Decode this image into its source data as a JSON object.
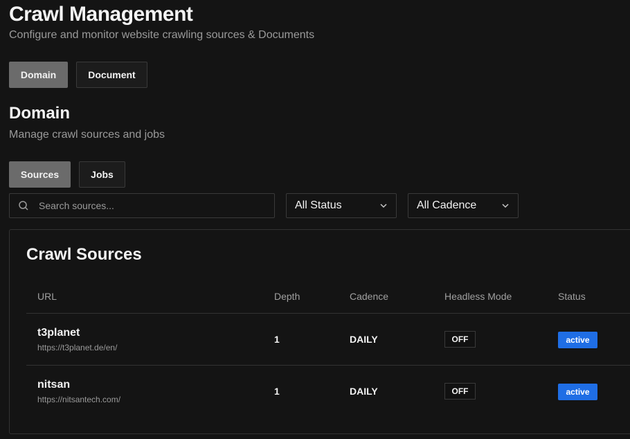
{
  "header": {
    "title": "Crawl Management",
    "subtitle": "Configure and monitor website crawling sources & Documents"
  },
  "top_tabs": [
    {
      "label": "Domain",
      "active": true
    },
    {
      "label": "Document",
      "active": false
    }
  ],
  "section": {
    "title": "Domain",
    "subtitle": "Manage crawl sources and jobs"
  },
  "sub_tabs": [
    {
      "label": "Sources",
      "active": true
    },
    {
      "label": "Jobs",
      "active": false
    }
  ],
  "filters": {
    "search_placeholder": "Search sources...",
    "status_value": "All Status",
    "cadence_value": "All Cadence"
  },
  "table": {
    "title": "Crawl Sources",
    "columns": [
      "URL",
      "Depth",
      "Cadence",
      "Headless Mode",
      "Status"
    ],
    "rows": [
      {
        "name": "t3planet",
        "url": "https://t3planet.de/en/",
        "depth": "1",
        "cadence": "DAILY",
        "headless": "OFF",
        "status": "active"
      },
      {
        "name": "nitsan",
        "url": "https://nitsantech.com/",
        "depth": "1",
        "cadence": "DAILY",
        "headless": "OFF",
        "status": "active"
      }
    ]
  },
  "colors": {
    "background": "#141414",
    "active_tab": "#6b6b6b",
    "status_active": "#1f6ee5"
  },
  "icons": {
    "search": "search-icon",
    "dropdown": "chevron-down-icon"
  }
}
